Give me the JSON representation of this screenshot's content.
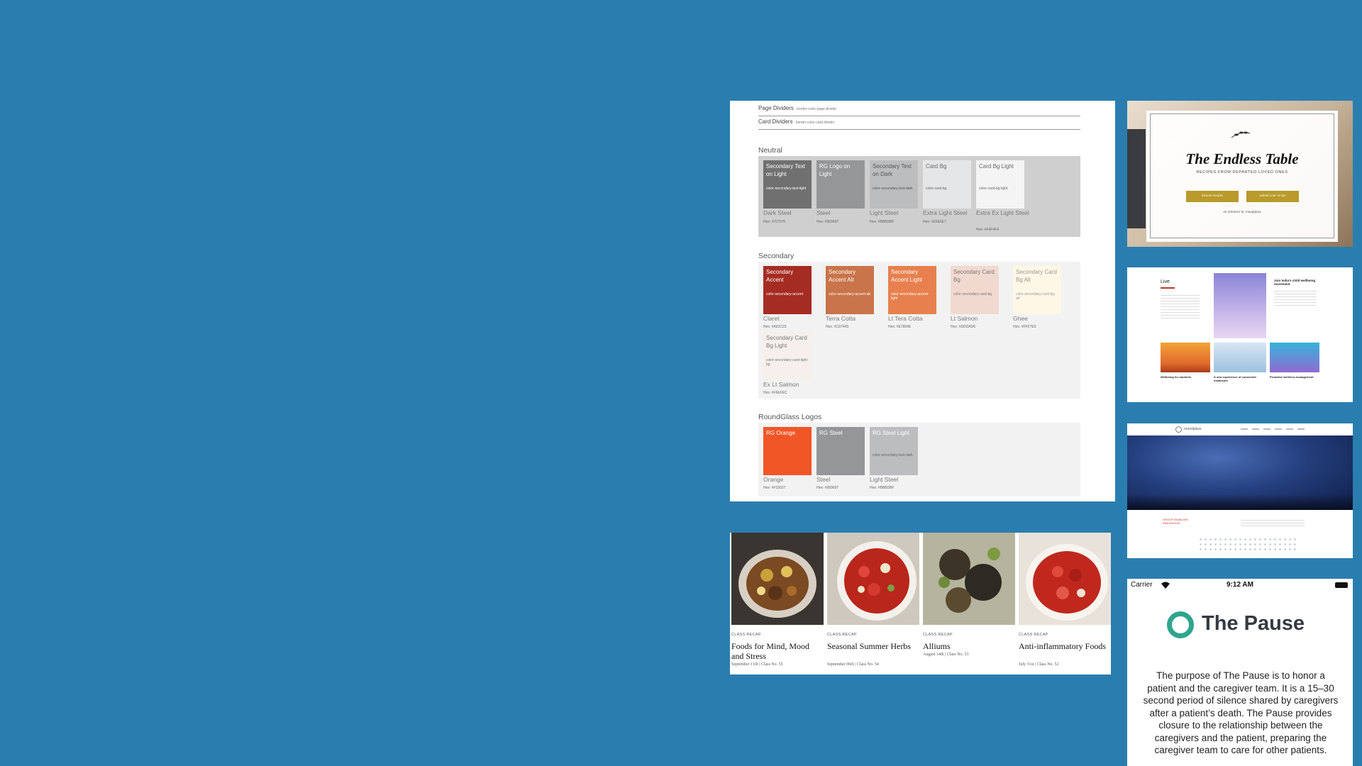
{
  "palette": {
    "dividers": [
      {
        "label": "Page Dividers",
        "token": "border-color-page-divider"
      },
      {
        "label": "Card Dividers",
        "token": "border-color-card-divider"
      }
    ],
    "neutral": {
      "title": "Neutral",
      "swatches": [
        {
          "label": "Secondary Text on Light",
          "token": "color-secondary-text-light",
          "name": "Dark Steel",
          "hex": "Hex: #707070",
          "color": "#707070"
        },
        {
          "label": "RG Logo on Light",
          "token": "",
          "name": "Steel",
          "hex": "Hex: #959697",
          "color": "#959697"
        },
        {
          "label": "Secondary Text on Dark",
          "token": "color-secondary-text-dark",
          "name": "Light Steel",
          "hex": "Hex: #BBBDBF",
          "color": "#bbbdbf"
        },
        {
          "label": "Card Bg",
          "token": "color-card-bg",
          "name": "Extra Light Steel",
          "hex": "Hex: #E5E6E7",
          "color": "#e5e6e7"
        },
        {
          "label": "Card Bg Light",
          "token": "color-card-bg-light",
          "name": "Extra Ex Light Steel",
          "hex": "Hex: #F4F4F4",
          "color": "#f4f4f4"
        }
      ]
    },
    "secondary": {
      "title": "Secondary",
      "swatches": [
        {
          "label": "Secondary Accent",
          "token": "color-secondary-accent",
          "name": "Claret",
          "hex": "Hex: #A52C23",
          "color": "#a52c23"
        },
        {
          "label": "Secondary Accent Alt",
          "token": "color-secondary-accent-alt",
          "name": "Terra Cotta",
          "hex": "Hex: #C9744S",
          "color": "#c9744a"
        },
        {
          "label": "Secondary Accent Light",
          "token": "color-secondary-accent-light",
          "name": "Lt Tera Cotta",
          "hex": "Hex: #E7804E",
          "color": "#e7804e"
        },
        {
          "label": "Secondary Card Bg",
          "token": "color-secondary-card-bg",
          "name": "Lt Salmon",
          "hex": "Hex: #DDDAD6",
          "color": "#f2d9cf"
        },
        {
          "label": "Secondary Card Bg Alt",
          "token": "color-secondary-card-bg-alt",
          "name": "Ghee",
          "hex": "Hex: #FFF7E5",
          "color": "#fff7e5"
        },
        {
          "label": "Secondary Card Bg Light",
          "token": "color-secondary-card-light-bg",
          "name": "Ex Lt Salmon",
          "hex": "Hex: #F6EFEC",
          "color": "#f6efec"
        }
      ]
    },
    "logos": {
      "title": "RoundGlass Logos",
      "swatches": [
        {
          "label": "RG Orange",
          "token": "",
          "name": "Orange",
          "hex": "Hex: #F15627",
          "color": "#f15627"
        },
        {
          "label": "RG Steel",
          "token": "",
          "name": "Steel",
          "hex": "Hex: #959697",
          "color": "#959697"
        },
        {
          "label": "RG Steel Light",
          "token": "color-secondary-text-dark",
          "name": "Light Steel",
          "hex": "Hex: #BBBDBF",
          "color": "#bbbdbf"
        }
      ]
    }
  },
  "recipes": [
    {
      "category": "CLASS RECAP",
      "title": "Foods for Mind, Mood and Stress",
      "meta": "September 11th | Class No. 55"
    },
    {
      "category": "CLASS RECAP",
      "title": "Seasonal Summer Herbs",
      "meta": "September 06th | Class No. 54"
    },
    {
      "category": "CLASS RECAP",
      "title": "Alliums",
      "meta": "August 14th | Class No. 53"
    },
    {
      "category": "CLASS RECAP",
      "title": "Anti-inflammatory Foods",
      "meta": "July 31st | Class No. 52"
    }
  ],
  "endless": {
    "title": "The Endless Table",
    "subtitle": "RECIPES FROM DEPARTED LOVED ONES",
    "btn_browse": "browse recipes",
    "btn_submit": "submit your recipe",
    "initiative": "an initiative by roundglass"
  },
  "live": {
    "heading": "Live",
    "card1": "Join India's child wellbeing movement",
    "card2": "Wellbeing for students",
    "card3": "A new experience of connected healthcare",
    "card4": "Proactive wellness management"
  },
  "conf": {
    "brand": "roundglass",
    "tagline": "GROUP ENABLING INNOVATION"
  },
  "pause": {
    "carrier": "Carrier",
    "time": "9:12 AM",
    "title": "The Pause",
    "paragraph": "The purpose of The Pause is to honor a patient and the caregiver team. It is a 15–30 second period of silence shared by caregivers after a patient’s death. The Pause provides closure to the relationship between the caregivers and the patient, preparing the caregiver team to care for other patients."
  }
}
